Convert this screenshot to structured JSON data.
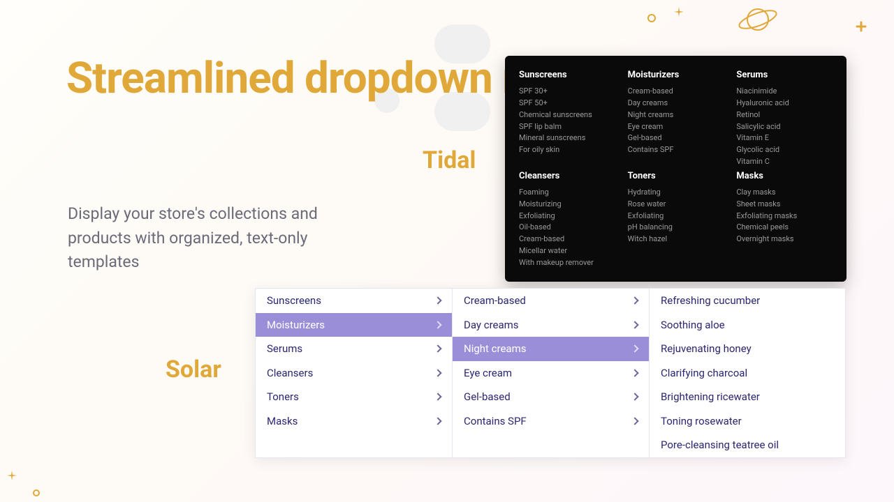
{
  "hero": {
    "title": "Streamlined dropdown menus",
    "subtitle": "Display your store's collections and products with organized, text-only templates"
  },
  "labels": {
    "tidal": "Tidal",
    "solar": "Solar"
  },
  "tidal": {
    "cols": [
      {
        "head": "Sunscreens",
        "items": [
          "SPF 30+",
          "SPF 50+",
          "Chemical sunscreens",
          "SPF lip balm",
          "Mineral sunscreens",
          "For oily skin"
        ]
      },
      {
        "head": "Moisturizers",
        "items": [
          "Cream-based",
          "Day creams",
          "Night creams",
          "Eye cream",
          "Gel-based",
          "Contains SPF"
        ]
      },
      {
        "head": "Serums",
        "items": [
          "Niacinimide",
          "Hyaluronic acid",
          "Retinol",
          "Salicylic acid",
          "Vitamin E",
          "Glycolic acid",
          "Vitamin C"
        ]
      },
      {
        "head": "Cleansers",
        "items": [
          "Foaming",
          "Moisturizing",
          "Exfoliating",
          "Oil-based",
          "Cream-based",
          "Micellar water",
          "With makeup remover"
        ]
      },
      {
        "head": "Toners",
        "items": [
          "Hydrating",
          "Rose water",
          "Exfoliating",
          "pH balancing",
          "Witch hazel"
        ]
      },
      {
        "head": "Masks",
        "items": [
          "Clay masks",
          "Sheet masks",
          "Exfoliating masks",
          "Chemical peels",
          "Overnight masks"
        ]
      }
    ]
  },
  "solar": {
    "col1": [
      {
        "label": "Sunscreens",
        "selected": false
      },
      {
        "label": "Moisturizers",
        "selected": true
      },
      {
        "label": "Serums",
        "selected": false
      },
      {
        "label": "Cleansers",
        "selected": false
      },
      {
        "label": "Toners",
        "selected": false
      },
      {
        "label": "Masks",
        "selected": false
      }
    ],
    "col2": [
      {
        "label": "Cream-based",
        "selected": false
      },
      {
        "label": "Day creams",
        "selected": false
      },
      {
        "label": "Night creams",
        "selected": true
      },
      {
        "label": "Eye cream",
        "selected": false
      },
      {
        "label": "Gel-based",
        "selected": false
      },
      {
        "label": "Contains SPF",
        "selected": false
      }
    ],
    "col3": [
      "Refreshing cucumber",
      "Soothing aloe",
      "Rejuvenating honey",
      "Clarifying charcoal",
      "Brightening ricewater",
      "Toning rosewater",
      "Pore-cleansing teatree oil"
    ]
  }
}
